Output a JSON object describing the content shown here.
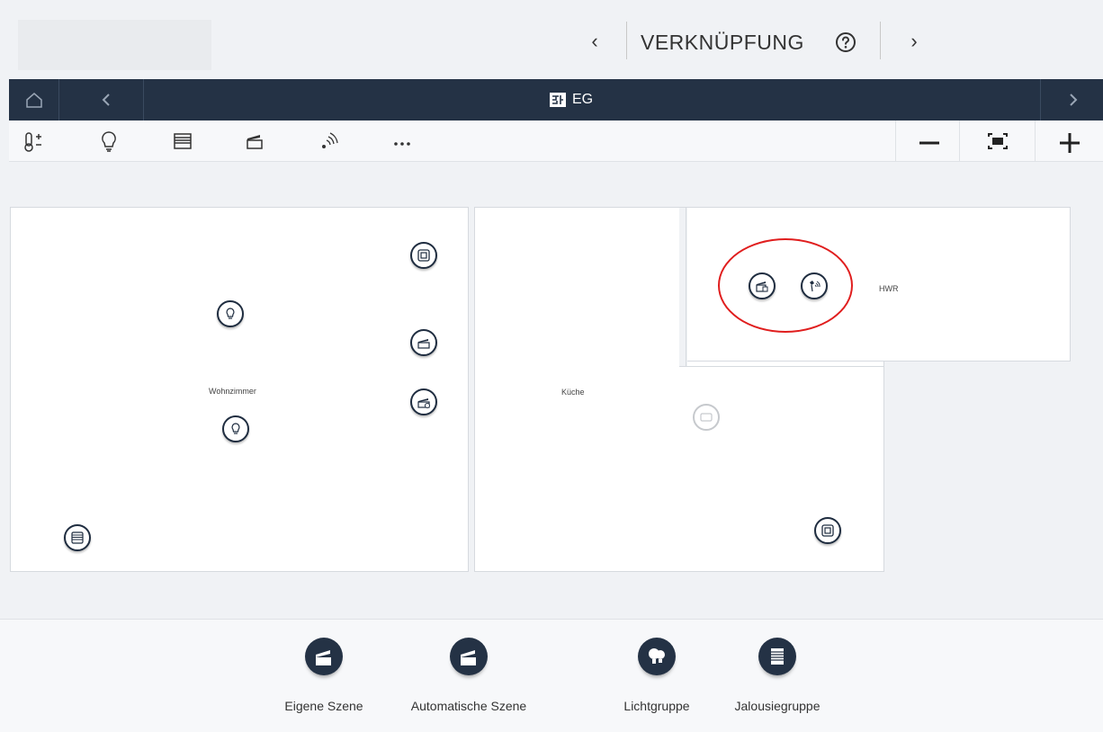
{
  "header": {
    "title": "VERKNÜPFUNG",
    "prev_glyph": "‹",
    "next_glyph": "›",
    "icons": [
      "chevron-left-icon",
      "help-icon",
      "chevron-right-icon"
    ]
  },
  "navbar": {
    "floor_title": "EG",
    "icons": [
      "home-icon",
      "chevron-left-icon",
      "floorplan-icon",
      "chevron-right-icon"
    ]
  },
  "toolbar": {
    "filters": [
      "thermostat-icon",
      "light-bulb-icon",
      "blind-icon",
      "scene-icon",
      "sensor-icon",
      "more-icon"
    ],
    "zoom": [
      "zoom-out-icon",
      "fit-screen-icon",
      "zoom-in-icon"
    ]
  },
  "rooms": [
    {
      "name": "Wohnzimmer"
    },
    {
      "name": "Küche"
    },
    {
      "name": "HWR"
    }
  ],
  "bottom_items": [
    {
      "label": "Eigene Szene",
      "icon": "scene-icon"
    },
    {
      "label": "Automatische Szene",
      "icon": "scene-icon"
    },
    {
      "label": "Lichtgruppe",
      "icon": "light-group-icon"
    },
    {
      "label": "Jalousiegruppe",
      "icon": "blind-group-icon"
    }
  ],
  "colors": {
    "navbar": "#243245",
    "highlight": "#e01e1e",
    "background": "#f0f2f5"
  }
}
